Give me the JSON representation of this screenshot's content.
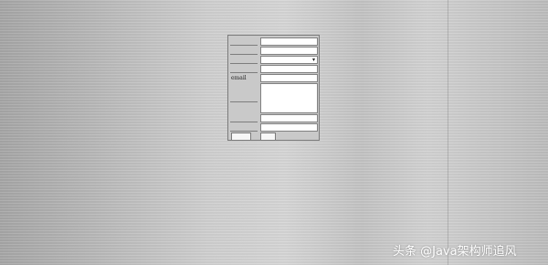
{
  "header": {
    "top_left_text": ""
  },
  "form": {
    "fields": [
      {
        "label": "",
        "value": ""
      },
      {
        "label": "",
        "value": ""
      },
      {
        "label": "",
        "value": ""
      },
      {
        "label": "",
        "value": ""
      },
      {
        "label": "email",
        "value": ""
      }
    ],
    "message": {
      "label": "",
      "value": ""
    },
    "extra_fields": [
      {
        "label": "",
        "value": ""
      },
      {
        "label": "",
        "value": ""
      }
    ],
    "buttons": {
      "primary": "",
      "secondary": ""
    }
  },
  "watermark": {
    "text": "头条 @Java架构师追风"
  }
}
